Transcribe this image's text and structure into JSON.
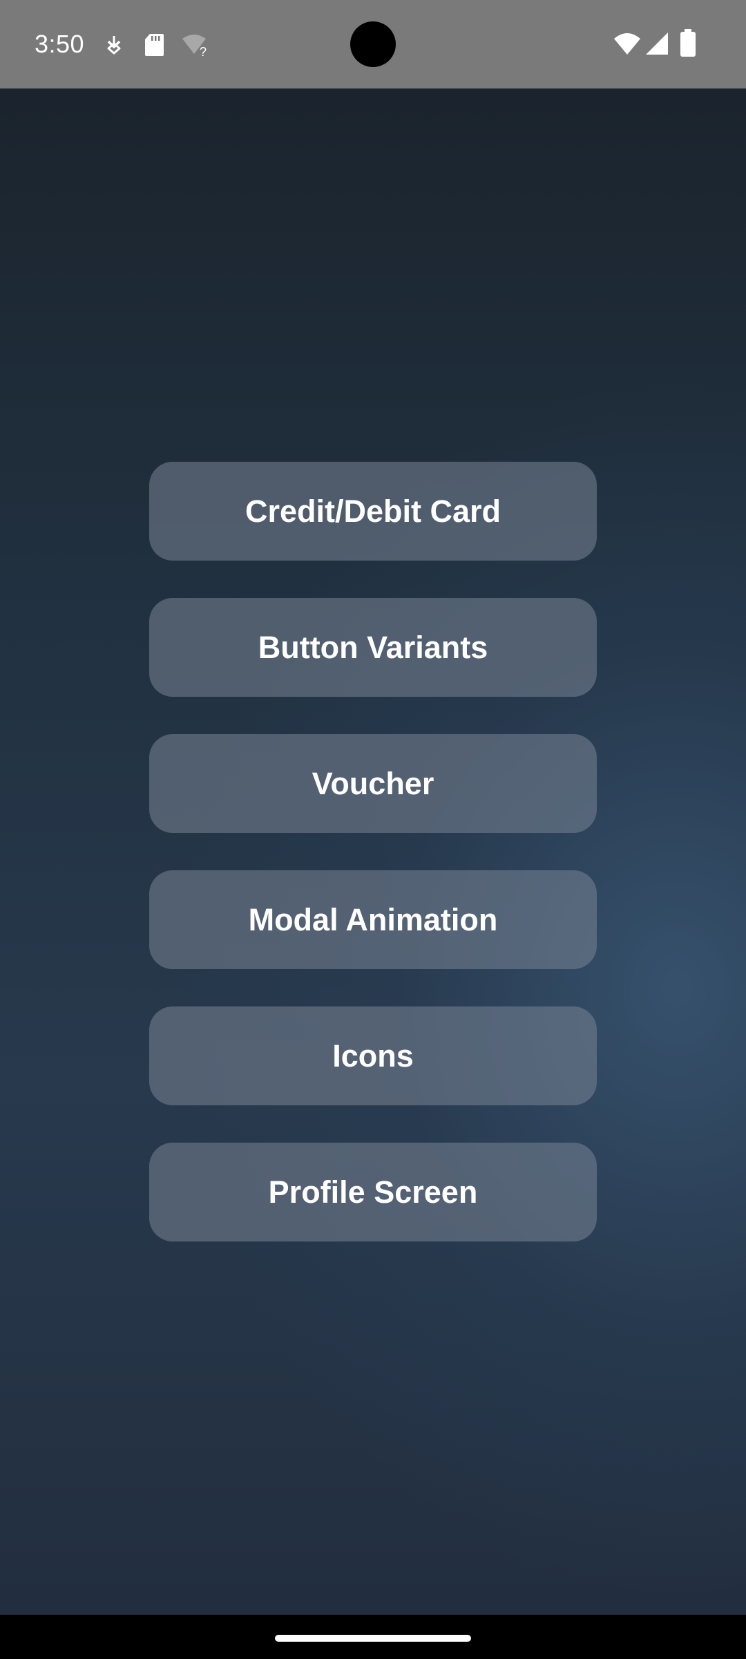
{
  "status_bar": {
    "time": "3:50",
    "icons_left": [
      "usb-debug-icon",
      "sd-card-icon",
      "wifi-unknown-icon"
    ],
    "icons_right": [
      "wifi-icon",
      "cellular-signal-icon",
      "battery-icon"
    ],
    "background": "#7a7a7a"
  },
  "menu": {
    "buttons": [
      {
        "label": "Credit/Debit Card"
      },
      {
        "label": "Button Variants"
      },
      {
        "label": "Voucher"
      },
      {
        "label": "Modal Animation"
      },
      {
        "label": "Icons"
      },
      {
        "label": "Profile Screen"
      }
    ]
  },
  "colors": {
    "button_text": "#ffffff",
    "background_dark": "#1b242d",
    "background_accent": "#37526e"
  }
}
